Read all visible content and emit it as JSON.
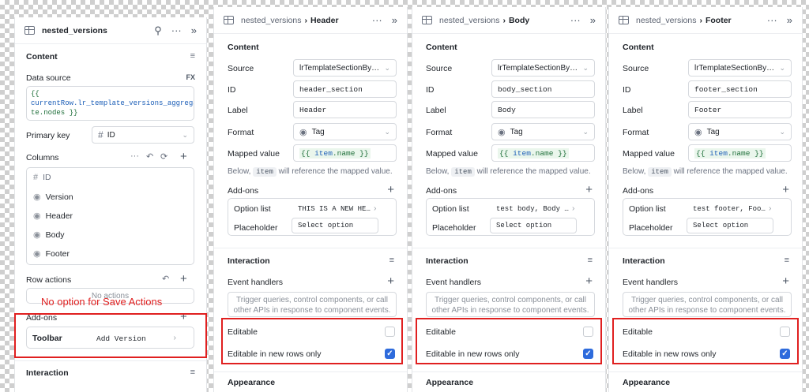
{
  "panel1": {
    "title": "nested_versions",
    "content_label": "Content",
    "data_source_label": "Data source",
    "fx_label": "FX",
    "data_source_code": [
      "{{",
      "currentRow.lr_template_versions_aggrega",
      "te.nodes }}"
    ],
    "primary_key_label": "Primary key",
    "primary_key_value": "ID",
    "columns_label": "Columns",
    "columns": [
      {
        "icon": "hash-icon",
        "label": "ID",
        "muted": true
      },
      {
        "icon": "tag-icon",
        "label": "Version",
        "muted": false
      },
      {
        "icon": "tag-icon",
        "label": "Header",
        "muted": false
      },
      {
        "icon": "tag-icon",
        "label": "Body",
        "muted": false
      },
      {
        "icon": "tag-icon",
        "label": "Footer",
        "muted": false
      }
    ],
    "row_actions_label": "Row actions",
    "no_actions_text": "No actions",
    "addons_label": "Add-ons",
    "toolbar_label": "Toolbar",
    "toolbar_value": "Add Version",
    "interaction_label": "Interaction",
    "annotation": "No option for Save Actions"
  },
  "panels": [
    {
      "parent": "nested_versions",
      "child": "Header",
      "content_label": "Content",
      "source_label": "Source",
      "source_value": "lrTemplateSectionBy…",
      "id_label": "ID",
      "id_value": "header_section",
      "label_label": "Label",
      "label_value": "Header",
      "format_label": "Format",
      "format_value": "Tag",
      "mapped_label": "Mapped value",
      "mapped_value_open": "{{",
      "mapped_value_item": "item",
      "mapped_value_name": ".name",
      "mapped_value_close": "}}",
      "hint_pre": "Below,",
      "hint_chip": "item",
      "hint_post": "will reference the mapped value.",
      "addons_label": "Add-ons",
      "option_list_label": "Option list",
      "option_list_value": "THIS IS A NEW HE…",
      "placeholder_label": "Placeholder",
      "placeholder_value": "Select option",
      "interaction_label": "Interaction",
      "event_handlers_label": "Event handlers",
      "event_hint": "Trigger queries, control components, or call other APIs in response to component events.",
      "editable_label": "Editable",
      "editable_checked": false,
      "new_rows_label": "Editable in new rows only",
      "new_rows_checked": true,
      "appearance_label": "Appearance"
    },
    {
      "parent": "nested_versions",
      "child": "Body",
      "content_label": "Content",
      "source_label": "Source",
      "source_value": "lrTemplateSectionBy…",
      "id_label": "ID",
      "id_value": "body_section",
      "label_label": "Label",
      "label_value": "Body",
      "format_label": "Format",
      "format_value": "Tag",
      "mapped_label": "Mapped value",
      "mapped_value_open": "{{",
      "mapped_value_item": "item",
      "mapped_value_name": ".name",
      "mapped_value_close": "}}",
      "hint_pre": "Below,",
      "hint_chip": "item",
      "hint_post": "will reference the mapped value.",
      "addons_label": "Add-ons",
      "option_list_label": "Option list",
      "option_list_value": "test body, Body …",
      "placeholder_label": "Placeholder",
      "placeholder_value": "Select option",
      "interaction_label": "Interaction",
      "event_handlers_label": "Event handlers",
      "event_hint": "Trigger queries, control components, or call other APIs in response to component events.",
      "editable_label": "Editable",
      "editable_checked": false,
      "new_rows_label": "Editable in new rows only",
      "new_rows_checked": true,
      "appearance_label": "Appearance"
    },
    {
      "parent": "nested_versions",
      "child": "Footer",
      "content_label": "Content",
      "source_label": "Source",
      "source_value": "lrTemplateSectionBy…",
      "id_label": "ID",
      "id_value": "footer_section",
      "label_label": "Label",
      "label_value": "Footer",
      "format_label": "Format",
      "format_value": "Tag",
      "mapped_label": "Mapped value",
      "mapped_value_open": "{{",
      "mapped_value_item": "item",
      "mapped_value_name": ".name",
      "mapped_value_close": "}}",
      "hint_pre": "Below,",
      "hint_chip": "item",
      "hint_post": "will reference the mapped value.",
      "addons_label": "Add-ons",
      "option_list_label": "Option list",
      "option_list_value": "test footer, Foo…",
      "placeholder_label": "Placeholder",
      "placeholder_value": "Select option",
      "interaction_label": "Interaction",
      "event_handlers_label": "Event handlers",
      "event_hint": "Trigger queries, control components, or call other APIs in response to component events.",
      "editable_label": "Editable",
      "editable_checked": false,
      "new_rows_label": "Editable in new rows only",
      "new_rows_checked": true,
      "appearance_label": "Appearance"
    }
  ],
  "colors": {
    "accent": "#2e6bdc",
    "annotation": "#e02020"
  }
}
